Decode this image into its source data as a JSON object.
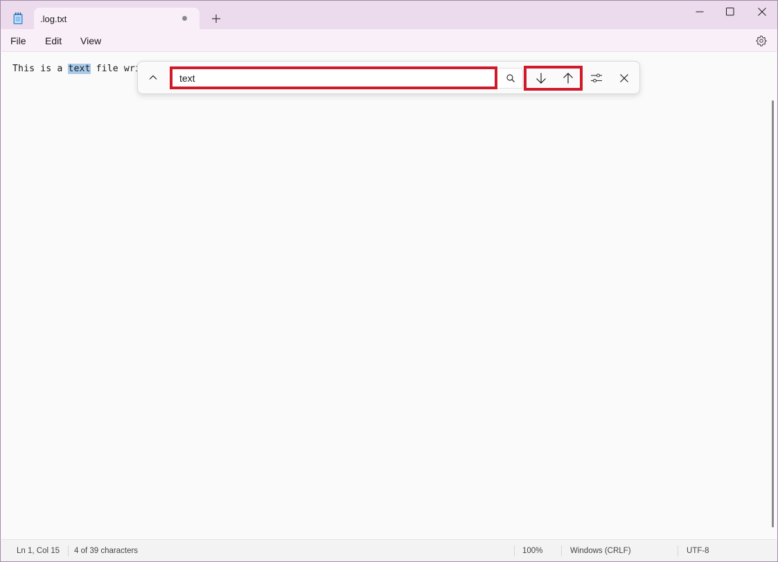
{
  "tab": {
    "title": ".log.txt"
  },
  "menu": {
    "file": "File",
    "edit": "Edit",
    "view": "View"
  },
  "editor": {
    "line_before": "This is a ",
    "match": "text",
    "line_after": " file wri"
  },
  "find": {
    "query": "text"
  },
  "status": {
    "position": "Ln 1, Col 15",
    "selection": "4 of 39 characters",
    "zoom": "100%",
    "line_ending": "Windows (CRLF)",
    "encoding": "UTF-8"
  },
  "colors": {
    "titlebar": "#ecdaed",
    "highlight": "#a8cbea",
    "annotation": "#d0192a"
  },
  "icons": [
    "notepad-icon",
    "plus-icon",
    "minimize-icon",
    "maximize-icon",
    "close-icon",
    "gear-icon",
    "chevron-up-icon",
    "search-icon",
    "arrow-down-icon",
    "arrow-up-icon",
    "options-icon",
    "close-find-icon"
  ]
}
